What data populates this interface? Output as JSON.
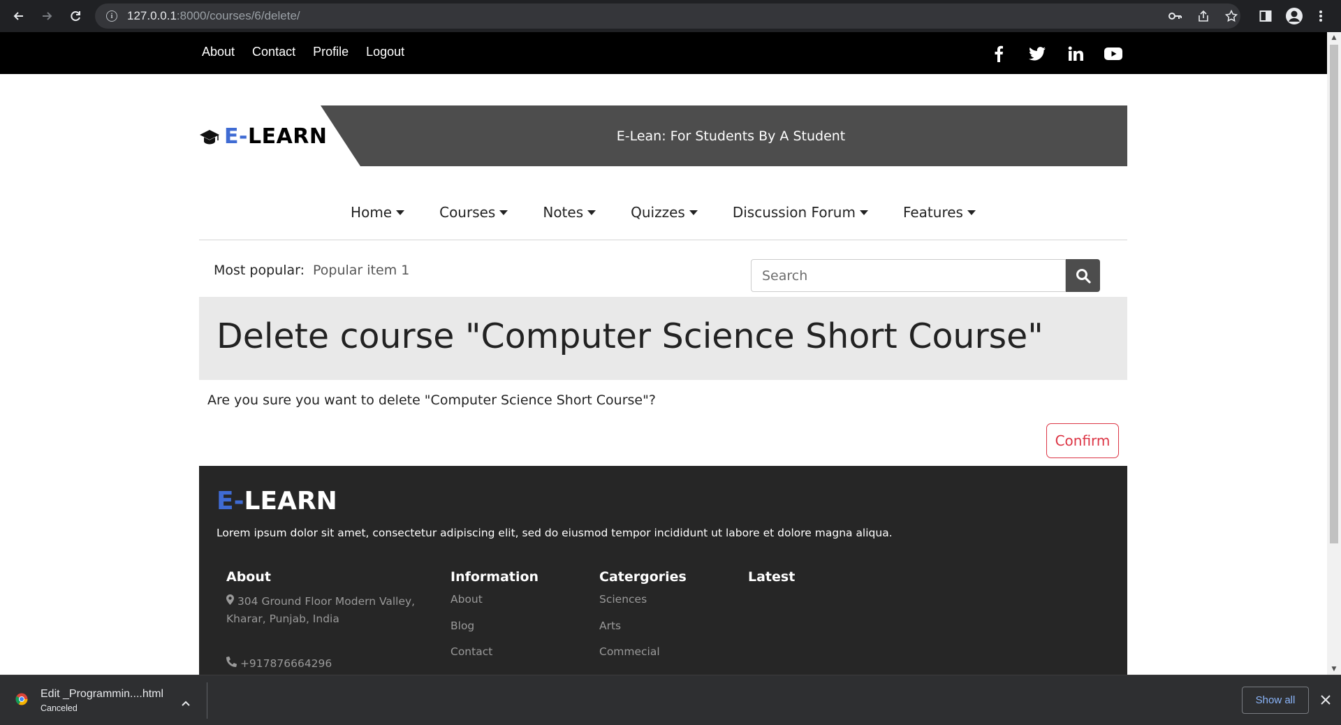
{
  "browser": {
    "url_host": "127.0.0.1",
    "url_path": ":8000/courses/6/delete/"
  },
  "topnav": {
    "links": [
      "About",
      "Contact",
      "Profile",
      "Logout"
    ],
    "social": [
      "facebook-icon",
      "twitter-icon",
      "linkedin-icon",
      "youtube-icon"
    ]
  },
  "header": {
    "logo_prefix": "E-",
    "logo_rest": "LEARN",
    "tagline": "E-Lean: For Students By A Student"
  },
  "mainnav": {
    "items": [
      "Home",
      "Courses",
      "Notes",
      "Quizzes",
      "Discussion Forum",
      "Features"
    ]
  },
  "popular": {
    "label": "Most popular:",
    "value": "Popular item 1"
  },
  "search": {
    "placeholder": "Search"
  },
  "page": {
    "title": "Delete course \"Computer Science Short Course\"",
    "question": "Are you sure you want to delete \"Computer Science Short Course\"?",
    "confirm_label": "Confirm"
  },
  "footer": {
    "logo_prefix": "E-",
    "logo_rest": "LEARN",
    "description": "Lorem ipsum dolor sit amet, consectetur adipiscing elit, sed do eiusmod tempor incididunt ut labore et dolore magna aliqua.",
    "about": {
      "heading": "About",
      "address_line1": "304 Ground Floor Modern Valley,",
      "address_line2": "Kharar, Punjab, India",
      "phone": "+917876664296"
    },
    "information": {
      "heading": "Information",
      "links": [
        "About",
        "Blog",
        "Contact"
      ]
    },
    "categories": {
      "heading": "Catergories",
      "links": [
        "Sciences",
        "Arts",
        "Commecial"
      ]
    },
    "latest": {
      "heading": "Latest"
    }
  },
  "download": {
    "filename": "Edit _Programmin....html",
    "status": "Canceled",
    "show_all": "Show all"
  },
  "colors": {
    "accent_blue": "#3f6bd3",
    "danger": "#dc3545",
    "banner": "#4d4d4d",
    "footer_bg": "#262626"
  }
}
